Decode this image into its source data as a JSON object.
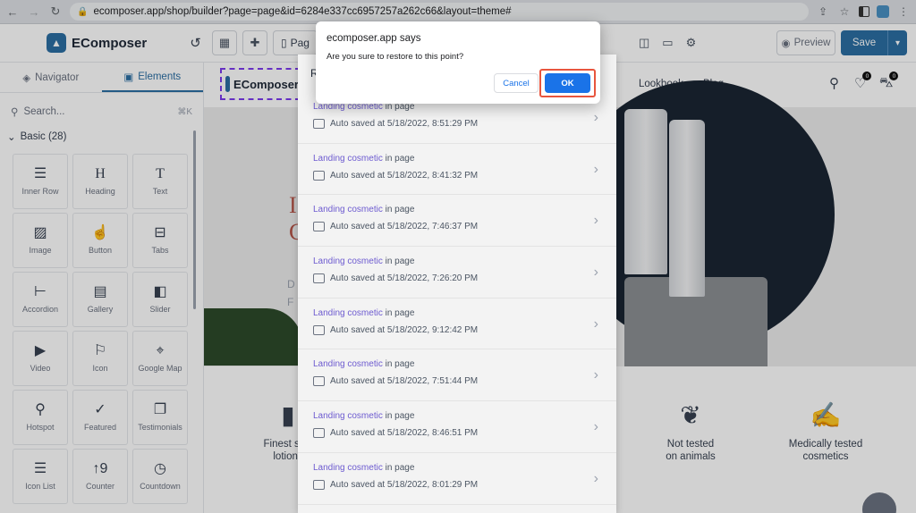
{
  "browser": {
    "url": "ecomposer.app/shop/builder?page=page&id=6284e337cc6957257a262c66&layout=theme#"
  },
  "app": {
    "logo": "EComposer",
    "page_label": "Pag",
    "preview": "Preview",
    "save": "Save"
  },
  "sidebar": {
    "tabs": [
      "Navigator",
      "Elements"
    ],
    "search_placeholder": "Search...",
    "search_shortcut": "⌘K",
    "section": "Basic (28)",
    "elements": [
      {
        "label": "Inner Row",
        "icon": "inner-row"
      },
      {
        "label": "Heading",
        "icon": "heading"
      },
      {
        "label": "Text",
        "icon": "text"
      },
      {
        "label": "Image",
        "icon": "image"
      },
      {
        "label": "Button",
        "icon": "button"
      },
      {
        "label": "Tabs",
        "icon": "tabs"
      },
      {
        "label": "Accordion",
        "icon": "accordion"
      },
      {
        "label": "Gallery",
        "icon": "gallery"
      },
      {
        "label": "Slider",
        "icon": "slider"
      },
      {
        "label": "Video",
        "icon": "video"
      },
      {
        "label": "Icon",
        "icon": "icon"
      },
      {
        "label": "Google Map",
        "icon": "google-map"
      },
      {
        "label": "Hotspot",
        "icon": "hotspot"
      },
      {
        "label": "Featured",
        "icon": "featured"
      },
      {
        "label": "Testimonials",
        "icon": "testimonials"
      },
      {
        "label": "Icon List",
        "icon": "icon-list"
      },
      {
        "label": "Counter",
        "icon": "counter"
      },
      {
        "label": "Countdown",
        "icon": "countdown"
      }
    ]
  },
  "site": {
    "logo": "EComposer",
    "menu": [
      "Lookbook",
      "Blog"
    ],
    "wishlist_count": "0",
    "cart_count": "0",
    "hero_red": "I\nC",
    "hero_grey": "D\nF",
    "features": [
      "Finest skin\nlotions",
      "Not tested\non animals",
      "Medically tested\ncosmetics"
    ]
  },
  "history": {
    "title": "R",
    "rows": [
      {
        "name": "Landing cosmetic",
        "suffix": "in page",
        "saved": "Auto saved at 5/18/2022, 8:51:29 PM"
      },
      {
        "name": "Landing cosmetic",
        "suffix": "in page",
        "saved": "Auto saved at 5/18/2022, 8:41:32 PM"
      },
      {
        "name": "Landing cosmetic",
        "suffix": "in page",
        "saved": "Auto saved at 5/18/2022, 7:46:37 PM"
      },
      {
        "name": "Landing cosmetic",
        "suffix": "in page",
        "saved": "Auto saved at 5/18/2022, 7:26:20 PM"
      },
      {
        "name": "Landing cosmetic",
        "suffix": "in page",
        "saved": "Auto saved at 5/18/2022, 9:12:42 PM"
      },
      {
        "name": "Landing cosmetic",
        "suffix": "in page",
        "saved": "Auto saved at 5/18/2022, 7:51:44 PM"
      },
      {
        "name": "Landing cosmetic",
        "suffix": "in page",
        "saved": "Auto saved at 5/18/2022, 8:46:51 PM"
      },
      {
        "name": "Landing cosmetic",
        "suffix": "in page",
        "saved": "Auto saved at 5/18/2022, 8:01:29 PM"
      }
    ]
  },
  "dialog": {
    "title": "ecomposer.app says",
    "message": "Are you sure to restore to this point?",
    "cancel": "Cancel",
    "ok": "OK"
  },
  "colors": {
    "brand": "#2b6ea3",
    "highlight": "#e8553e",
    "dialog_button": "#1a73e8",
    "history_name": "#6d5bd0"
  }
}
